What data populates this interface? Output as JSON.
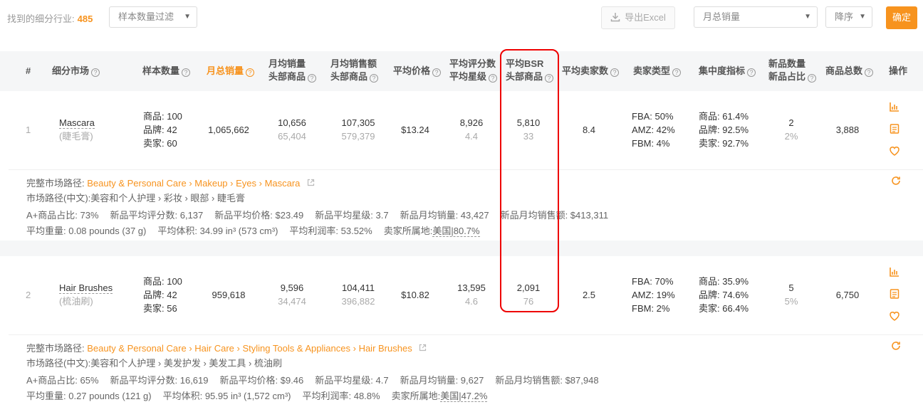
{
  "toolbar": {
    "found_label": "找到的细分行业:",
    "found_count": "485",
    "sample_filter": "样本数量过滤",
    "export_label": "导出Excel",
    "sort_field": "月总销量",
    "sort_order": "降序",
    "confirm_label": "确定"
  },
  "header": {
    "index": "#",
    "market": "细分市场",
    "sample": "样本数量",
    "total_sales": "月总销量",
    "avg_sales_1": "月均销量",
    "avg_sales_2": "头部商品",
    "avg_revenue_1": "月均销售额",
    "avg_revenue_2": "头部商品",
    "avg_price": "平均价格",
    "avg_rating_1": "平均评分数",
    "avg_rating_2": "平均星级",
    "avg_bsr_1": "平均BSR",
    "avg_bsr_2": "头部商品",
    "avg_sellers": "平均卖家数",
    "seller_type": "卖家类型",
    "concentration": "集中度指标",
    "new_count_1": "新品数量",
    "new_count_2": "新品占比",
    "total_products": "商品总数",
    "actions": "操作"
  },
  "colors": {
    "accent": "#f7931e",
    "highlight": "#e00000"
  },
  "rows": [
    {
      "index": "1",
      "name": "Mascara",
      "name_cn": "(睫毛膏)",
      "sample_products": "商品: 100",
      "sample_brands": "品牌: 42",
      "sample_sellers": "卖家: 60",
      "total_sales": "1,065,662",
      "avg_sales": "10,656",
      "avg_sales_top": "65,404",
      "avg_revenue": "107,305",
      "avg_revenue_top": "579,379",
      "avg_price": "$13.24",
      "avg_ratings": "8,926",
      "avg_stars": "4.4",
      "avg_bsr": "5,810",
      "avg_bsr_top": "33",
      "avg_sellers": "8.4",
      "fba": "FBA: 50%",
      "amz": "AMZ: 42%",
      "fbm": "FBM: 4%",
      "conc_products": "商品: 61.4%",
      "conc_brands": "品牌: 92.5%",
      "conc_sellers": "卖家: 92.7%",
      "new_count": "2",
      "new_ratio": "2%",
      "total_products": "3,888",
      "path_label": "完整市场路径:",
      "path_parts": [
        "Beauty & Personal Care",
        "Makeup",
        "Eyes",
        "Mascara"
      ],
      "path_cn_label": "市场路径(中文):",
      "path_cn": "美容和个人护理 › 彩妆 › 眼部 › 睫毛膏",
      "aplus": "A+商品占比: 73%",
      "new_rating": "新品平均评分数: 6,137",
      "new_price": "新品平均价格: $23.49",
      "new_stars": "新品平均星级: 3.7",
      "new_sales": "新品月均销量: 43,427",
      "new_revenue": "新品月均销售额: $413,311",
      "weight": "平均重量: 0.08 pounds (37 g)",
      "volume": "平均体积: 34.99 in³ (573 cm³)",
      "margin": "平均利润率: 53.52%",
      "origin_label": "卖家所属地:",
      "origin": "美国|80.7%"
    },
    {
      "index": "2",
      "name": "Hair Brushes",
      "name_cn": "(梳油刷)",
      "sample_products": "商品: 100",
      "sample_brands": "品牌: 42",
      "sample_sellers": "卖家: 56",
      "total_sales": "959,618",
      "avg_sales": "9,596",
      "avg_sales_top": "34,474",
      "avg_revenue": "104,411",
      "avg_revenue_top": "396,882",
      "avg_price": "$10.82",
      "avg_ratings": "13,595",
      "avg_stars": "4.6",
      "avg_bsr": "2,091",
      "avg_bsr_top": "76",
      "avg_sellers": "2.5",
      "fba": "FBA: 70%",
      "amz": "AMZ: 19%",
      "fbm": "FBM: 2%",
      "conc_products": "商品: 35.9%",
      "conc_brands": "品牌: 74.6%",
      "conc_sellers": "卖家: 66.4%",
      "new_count": "5",
      "new_ratio": "5%",
      "total_products": "6,750",
      "path_label": "完整市场路径:",
      "path_parts": [
        "Beauty & Personal Care",
        "Hair Care",
        "Styling Tools & Appliances",
        "Hair Brushes"
      ],
      "path_cn_label": "市场路径(中文):",
      "path_cn": "美容和个人护理 › 美发护发 › 美发工具 › 梳油刷",
      "aplus": "A+商品占比: 65%",
      "new_rating": "新品平均评分数: 16,619",
      "new_price": "新品平均价格: $9.46",
      "new_stars": "新品平均星级: 4.7",
      "new_sales": "新品月均销量: 9,627",
      "new_revenue": "新品月均销售额: $87,948",
      "weight": "平均重量: 0.27 pounds (121 g)",
      "volume": "平均体积: 95.95 in³ (1,572 cm³)",
      "margin": "平均利润率: 48.8%",
      "origin_label": "卖家所属地:",
      "origin": "美国|47.2%"
    }
  ]
}
